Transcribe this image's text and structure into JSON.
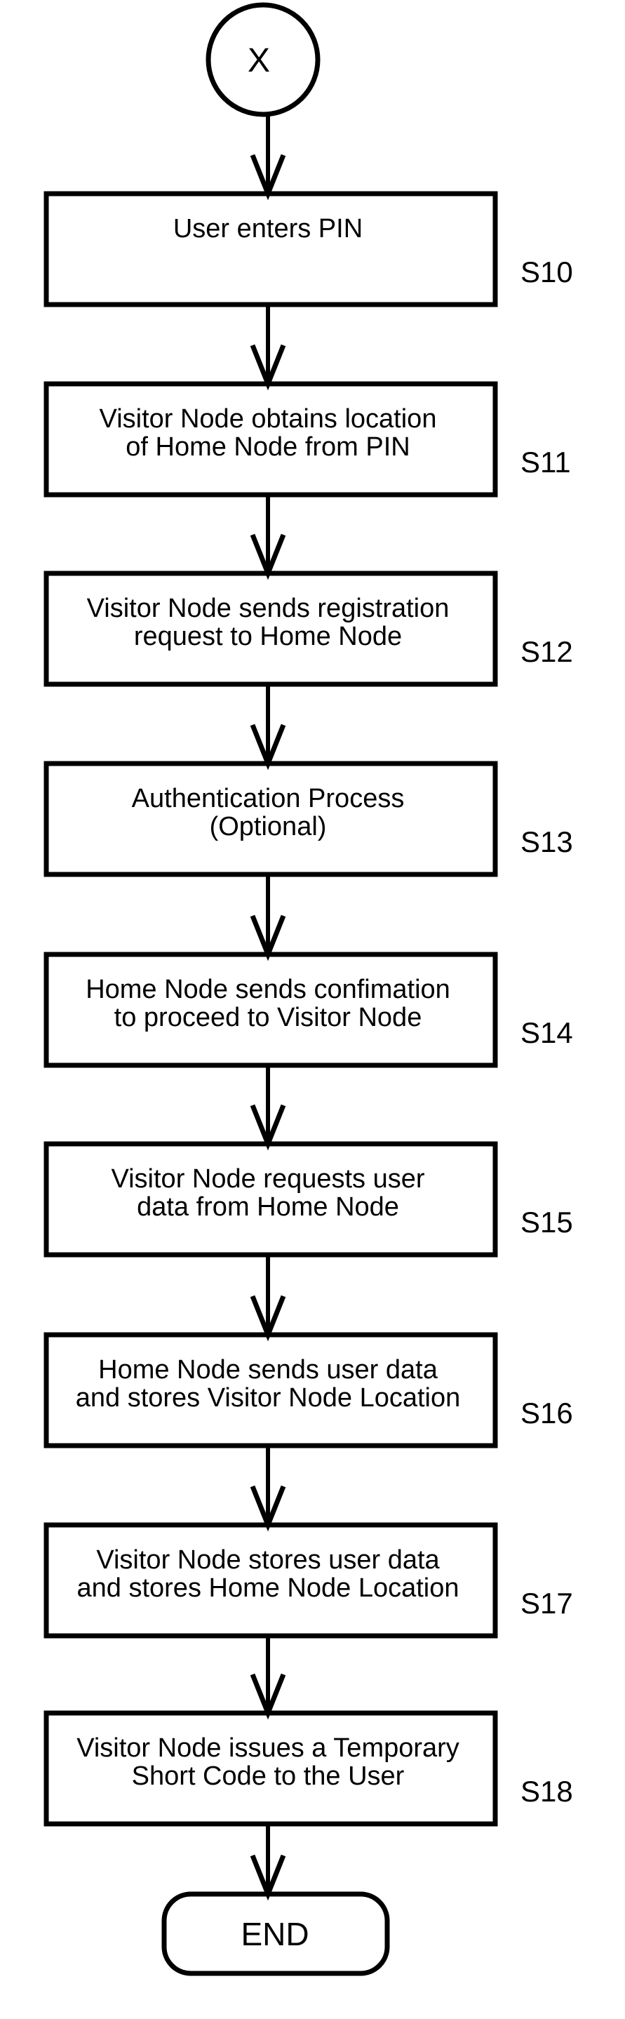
{
  "start": {
    "label": "X"
  },
  "steps": [
    {
      "id": "S10",
      "lines": [
        "User enters PIN"
      ]
    },
    {
      "id": "S11",
      "lines": [
        "Visitor Node obtains location",
        "of Home Node from PIN"
      ]
    },
    {
      "id": "S12",
      "lines": [
        "Visitor Node sends registration",
        "request to Home Node"
      ]
    },
    {
      "id": "S13",
      "lines": [
        "Authentication Process",
        "(Optional)"
      ]
    },
    {
      "id": "S14",
      "lines": [
        "Home Node sends confimation",
        "to proceed to Visitor Node"
      ]
    },
    {
      "id": "S15",
      "lines": [
        "Visitor Node requests user",
        "data from Home Node"
      ]
    },
    {
      "id": "S16",
      "lines": [
        "Home Node sends user data",
        "and stores Visitor Node Location"
      ]
    },
    {
      "id": "S17",
      "lines": [
        "Visitor Node stores user data",
        "and stores Home Node Location"
      ]
    },
    {
      "id": "S18",
      "lines": [
        "Visitor Node issues a Temporary",
        "Short Code to the User"
      ]
    }
  ],
  "end": {
    "label": "END"
  }
}
